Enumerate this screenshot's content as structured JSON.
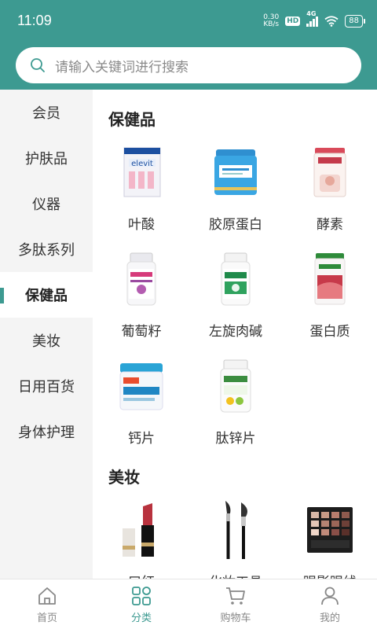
{
  "status_bar": {
    "time": "11:09",
    "net_speed_value": "0.30",
    "net_speed_unit": "KB/s",
    "hd_badge": "HD",
    "signal_label": "4G",
    "battery": "88"
  },
  "search": {
    "placeholder": "请输入关键词进行搜索"
  },
  "colors": {
    "accent": "#3d9a91",
    "sidebar_bg": "#f4f4f4"
  },
  "sidebar": {
    "items": [
      {
        "label": "会员",
        "active": false
      },
      {
        "label": "护肤品",
        "active": false
      },
      {
        "label": "仪器",
        "active": false
      },
      {
        "label": "多肽系列",
        "active": false
      },
      {
        "label": "保健品",
        "active": true
      },
      {
        "label": "美妆",
        "active": false
      },
      {
        "label": "日用百货",
        "active": false
      },
      {
        "label": "身体护理",
        "active": false
      }
    ]
  },
  "sections": [
    {
      "title": "保健品",
      "products": [
        {
          "label": "叶酸",
          "icon": "supplement-box-icon"
        },
        {
          "label": "胶原蛋白",
          "icon": "powder-can-icon"
        },
        {
          "label": "酵素",
          "icon": "canister-icon"
        },
        {
          "label": "葡萄籽",
          "icon": "pill-bottle-icon"
        },
        {
          "label": "左旋肉碱",
          "icon": "pill-bottle-icon"
        },
        {
          "label": "蛋白质",
          "icon": "shake-canister-icon"
        },
        {
          "label": "钙片",
          "icon": "tub-icon"
        },
        {
          "label": "肽锌片",
          "icon": "pill-bottle-icon"
        }
      ]
    },
    {
      "title": "美妆",
      "products": [
        {
          "label": "口红",
          "icon": "lipstick-icon"
        },
        {
          "label": "化妆工具",
          "icon": "makeup-brush-icon"
        },
        {
          "label": "眼影眼线",
          "icon": "eyeshadow-palette-icon"
        }
      ]
    }
  ],
  "tabbar": {
    "tabs": [
      {
        "label": "首页",
        "icon": "home-icon",
        "active": false
      },
      {
        "label": "分类",
        "icon": "category-grid-icon",
        "active": true
      },
      {
        "label": "购物车",
        "icon": "cart-icon",
        "active": false
      },
      {
        "label": "我的",
        "icon": "user-icon",
        "active": false
      }
    ]
  }
}
